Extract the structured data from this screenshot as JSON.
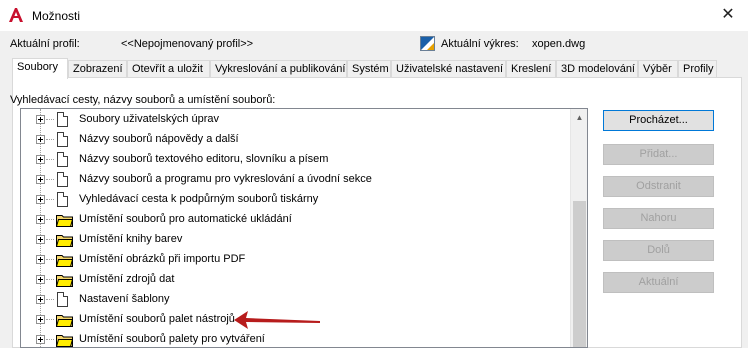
{
  "window": {
    "title": "Možnosti",
    "close_glyph": "✕",
    "icon": "autocad-a-icon",
    "accent_color": "#c8102e"
  },
  "profile": {
    "label": "Aktuální profil:",
    "value": "<<Nepojmenovaný profil>>",
    "drawing_label": "Aktuální výkres:",
    "drawing_value": "xopen.dwg"
  },
  "tabs": [
    {
      "label": "Soubory",
      "active": true
    },
    {
      "label": "Zobrazení"
    },
    {
      "label": "Otevřít a uložit"
    },
    {
      "label": "Vykreslování a publikování"
    },
    {
      "label": "Systém"
    },
    {
      "label": "Uživatelské nastavení"
    },
    {
      "label": "Kreslení"
    },
    {
      "label": "3D modelování"
    },
    {
      "label": "Výběr"
    },
    {
      "label": "Profily"
    }
  ],
  "section_label": "Vyhledávací cesty, názvy souborů a umístění souborů:",
  "tree_items": [
    {
      "label": "Soubory uživatelských úprav",
      "icon": "document"
    },
    {
      "label": "Názvy souborů nápovědy a další",
      "icon": "document"
    },
    {
      "label": "Názvy souborů textového editoru, slovníku a písem",
      "icon": "document"
    },
    {
      "label": "Názvy souborů a programu pro vykreslování a úvodní sekce",
      "icon": "document"
    },
    {
      "label": "Vyhledávací cesta k podpůrným souborů tiskárny",
      "icon": "document"
    },
    {
      "label": "Umístění souborů pro automatické ukládání",
      "icon": "folder"
    },
    {
      "label": "Umístění knihy barev",
      "icon": "folder"
    },
    {
      "label": "Umístění obrázků při importu PDF",
      "icon": "folder"
    },
    {
      "label": "Umístění zdrojů dat",
      "icon": "folder"
    },
    {
      "label": "Nastavení šablony",
      "icon": "document"
    },
    {
      "label": "Umístění souborů palet nástrojů",
      "icon": "folder"
    },
    {
      "label": "Umístění souborů palety pro vytváření",
      "icon": "folder"
    }
  ],
  "buttons": {
    "browse": "Procházet...",
    "add": "Přidat...",
    "remove": "Odstranit",
    "up": "Nahoru",
    "down": "Dolů",
    "current": "Aktuální"
  },
  "scroll_up_glyph": "▲",
  "annotation_arrow_color": "#b71c1c"
}
